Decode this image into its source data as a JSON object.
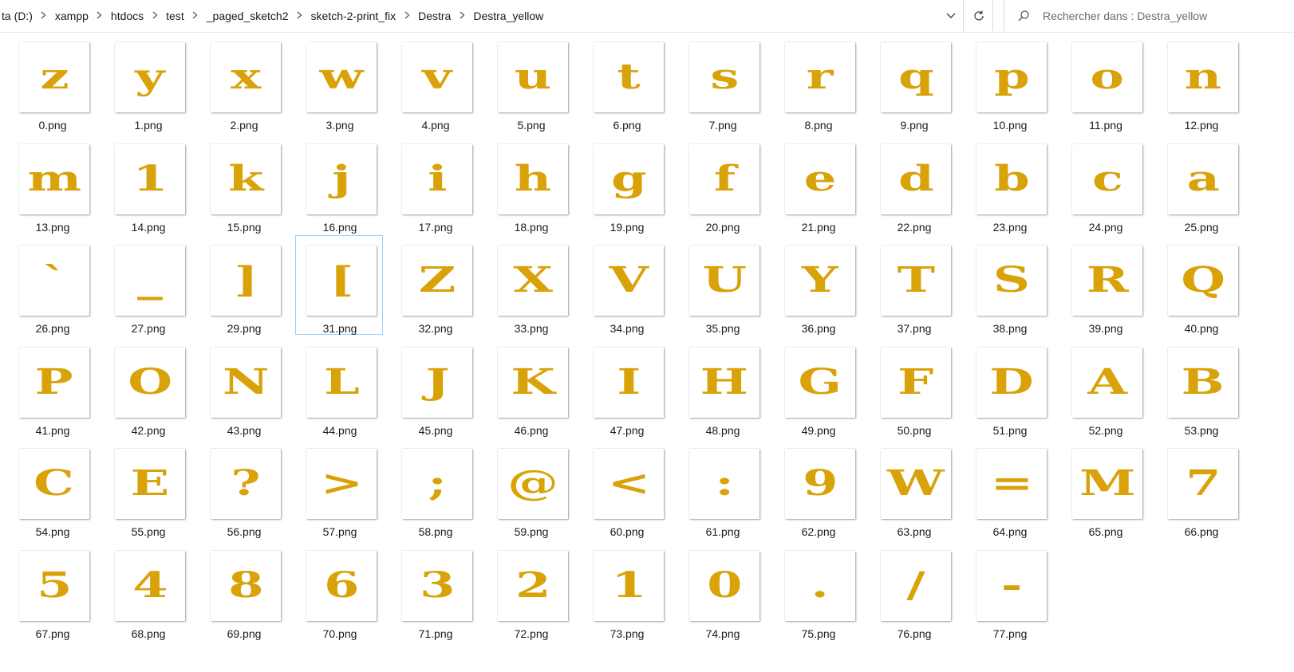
{
  "address_bar": {
    "breadcrumbs": [
      "ta (D:)",
      "xampp",
      "htdocs",
      "test",
      "_paged_sketch2",
      "sketch-2-print_fix",
      "Destra",
      "Destra_yellow"
    ],
    "separator_icon": "chevron-right-icon",
    "dropdown_icon": "chevron-down-icon",
    "refresh_icon": "refresh-icon"
  },
  "search": {
    "placeholder": "Rechercher dans : Destra_yellow",
    "value": "",
    "icon": "search-icon"
  },
  "glyph_color": "#d8a208",
  "files": [
    {
      "name": "0.png",
      "glyph": "z"
    },
    {
      "name": "1.png",
      "glyph": "y"
    },
    {
      "name": "2.png",
      "glyph": "x"
    },
    {
      "name": "3.png",
      "glyph": "w"
    },
    {
      "name": "4.png",
      "glyph": "v"
    },
    {
      "name": "5.png",
      "glyph": "u"
    },
    {
      "name": "6.png",
      "glyph": "t"
    },
    {
      "name": "7.png",
      "glyph": "s"
    },
    {
      "name": "8.png",
      "glyph": "r"
    },
    {
      "name": "9.png",
      "glyph": "q"
    },
    {
      "name": "10.png",
      "glyph": "p"
    },
    {
      "name": "11.png",
      "glyph": "o"
    },
    {
      "name": "12.png",
      "glyph": "n"
    },
    {
      "name": "13.png",
      "glyph": "m"
    },
    {
      "name": "14.png",
      "glyph": "1"
    },
    {
      "name": "15.png",
      "glyph": "k"
    },
    {
      "name": "16.png",
      "glyph": "j"
    },
    {
      "name": "17.png",
      "glyph": "i"
    },
    {
      "name": "18.png",
      "glyph": "h"
    },
    {
      "name": "19.png",
      "glyph": "g"
    },
    {
      "name": "20.png",
      "glyph": "f"
    },
    {
      "name": "21.png",
      "glyph": "e"
    },
    {
      "name": "22.png",
      "glyph": "d"
    },
    {
      "name": "23.png",
      "glyph": "b"
    },
    {
      "name": "24.png",
      "glyph": "c"
    },
    {
      "name": "25.png",
      "glyph": "a"
    },
    {
      "name": "26.png",
      "glyph": "`"
    },
    {
      "name": "27.png",
      "glyph": "_"
    },
    {
      "name": "29.png",
      "glyph": "]"
    },
    {
      "name": "31.png",
      "glyph": "[",
      "selected": true
    },
    {
      "name": "32.png",
      "glyph": "Z"
    },
    {
      "name": "33.png",
      "glyph": "X"
    },
    {
      "name": "34.png",
      "glyph": "V"
    },
    {
      "name": "35.png",
      "glyph": "U"
    },
    {
      "name": "36.png",
      "glyph": "Y"
    },
    {
      "name": "37.png",
      "glyph": "T"
    },
    {
      "name": "38.png",
      "glyph": "S"
    },
    {
      "name": "39.png",
      "glyph": "R"
    },
    {
      "name": "40.png",
      "glyph": "Q"
    },
    {
      "name": "41.png",
      "glyph": "P"
    },
    {
      "name": "42.png",
      "glyph": "O"
    },
    {
      "name": "43.png",
      "glyph": "N"
    },
    {
      "name": "44.png",
      "glyph": "L"
    },
    {
      "name": "45.png",
      "glyph": "J"
    },
    {
      "name": "46.png",
      "glyph": "K"
    },
    {
      "name": "47.png",
      "glyph": "I"
    },
    {
      "name": "48.png",
      "glyph": "H"
    },
    {
      "name": "49.png",
      "glyph": "G"
    },
    {
      "name": "50.png",
      "glyph": "F"
    },
    {
      "name": "51.png",
      "glyph": "D"
    },
    {
      "name": "52.png",
      "glyph": "A"
    },
    {
      "name": "53.png",
      "glyph": "B"
    },
    {
      "name": "54.png",
      "glyph": "C"
    },
    {
      "name": "55.png",
      "glyph": "E"
    },
    {
      "name": "56.png",
      "glyph": "?"
    },
    {
      "name": "57.png",
      "glyph": ">"
    },
    {
      "name": "58.png",
      "glyph": ";"
    },
    {
      "name": "59.png",
      "glyph": "@"
    },
    {
      "name": "60.png",
      "glyph": "<"
    },
    {
      "name": "61.png",
      "glyph": ":"
    },
    {
      "name": "62.png",
      "glyph": "9"
    },
    {
      "name": "63.png",
      "glyph": "W"
    },
    {
      "name": "64.png",
      "glyph": "="
    },
    {
      "name": "65.png",
      "glyph": "M"
    },
    {
      "name": "66.png",
      "glyph": "7"
    },
    {
      "name": "67.png",
      "glyph": "5"
    },
    {
      "name": "68.png",
      "glyph": "4"
    },
    {
      "name": "69.png",
      "glyph": "8"
    },
    {
      "name": "70.png",
      "glyph": "6"
    },
    {
      "name": "71.png",
      "glyph": "3"
    },
    {
      "name": "72.png",
      "glyph": "2"
    },
    {
      "name": "73.png",
      "glyph": "1"
    },
    {
      "name": "74.png",
      "glyph": "0"
    },
    {
      "name": "75.png",
      "glyph": "."
    },
    {
      "name": "76.png",
      "glyph": "/"
    },
    {
      "name": "77.png",
      "glyph": "-"
    }
  ]
}
